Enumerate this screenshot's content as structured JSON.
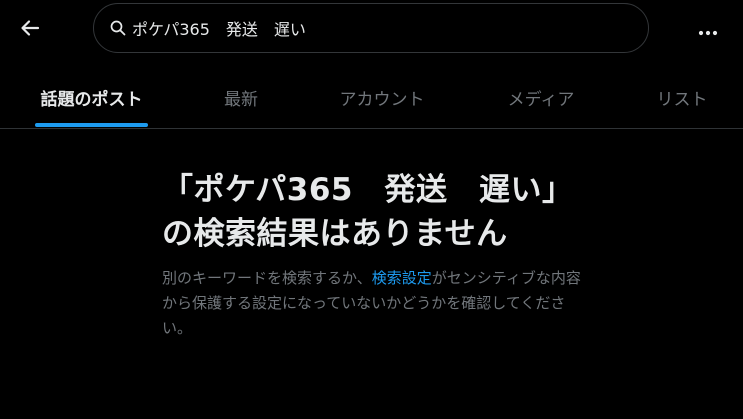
{
  "colors": {
    "background": "#000000",
    "text_primary": "#e7e9ea",
    "text_secondary": "#71767b",
    "accent": "#1d9bf0",
    "border": "#333639"
  },
  "header": {
    "back_icon": "arrow-left-icon",
    "search": {
      "icon": "search-icon",
      "value": "ポケパ365　発送　遅い"
    },
    "more_icon": "more-horizontal-icon"
  },
  "tabs": [
    {
      "label": "話題のポスト",
      "active": true
    },
    {
      "label": "最新",
      "active": false
    },
    {
      "label": "アカウント",
      "active": false
    },
    {
      "label": "メディア",
      "active": false
    },
    {
      "label": "リスト",
      "active": false
    }
  ],
  "empty_state": {
    "title": "「ポケパ365　発送　遅い」の検索結果はありません",
    "desc_before": "別のキーワードを検索するか、",
    "desc_link": "検索設定",
    "desc_after": "がセンシティブな内容から保護する設定になっていないかどうかを確認してください。"
  }
}
